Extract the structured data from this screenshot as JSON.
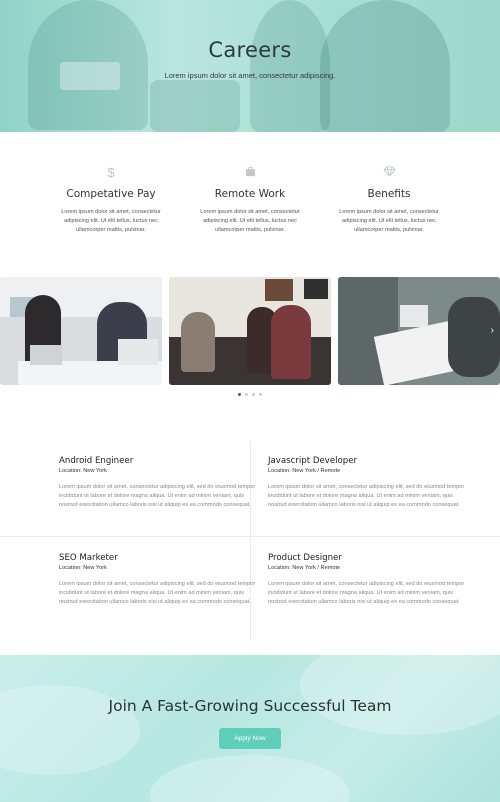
{
  "hero": {
    "title": "Careers",
    "subtitle": "Lorem ipsum dolor sit amet, consectetur adipiscing."
  },
  "features": [
    {
      "icon": "dollar-icon",
      "title": "Competative Pay",
      "text": "Lorem ipsum dolor sit amet, consectetur adipiscing elit. Ut elit tellus, luctus nec ullamcorper mattis, pulvinar."
    },
    {
      "icon": "briefcase-icon",
      "title": "Remote Work",
      "text": "Lorem ipsum dolor sit amet, consectetur adipiscing elit. Ut elit tellus, luctus nec ullamcorper mattis, pulvinar."
    },
    {
      "icon": "diamond-icon",
      "title": "Benefits",
      "text": "Lorem ipsum dolor sit amet, consectetur adipiscing elit. Ut elit tellus, luctus nec ullamcorper mattis, pulvinar."
    }
  ],
  "carousel": {
    "next_icon": "chevron-right-icon",
    "dots": 4,
    "active_dot": 0
  },
  "jobs": [
    {
      "title": "Android Engineer",
      "location": "Location: New York",
      "description": "Lorem ipsum dolor sit amet, consectetur adipiscing elit, sed do eiusmod tempor incididunt ut labore et dolore magna aliqua. Ut enim ad minim veniam, quis nostrud exercitation ullamco laboris nisi ut aliquip ex ea commodo consequat."
    },
    {
      "title": "Javascript Developer",
      "location": "Location: New York / Remote",
      "description": "Lorem ipsum dolor sit amet, consectetur adipiscing elit, sed do eiusmod tempor incididunt ut labore et dolore magna aliqua. Ut enim ad minim veniam, quis nostrud exercitation ullamco laboris nisi ut aliquip ex ea commodo consequat."
    },
    {
      "title": "SEO Marketer",
      "location": "Location: New York",
      "description": "Lorem ipsum dolor sit amet, consectetur adipiscing elit, sed do eiusmod tempor incididunt ut labore et dolore magna aliqua. Ut enim ad minim veniam, quis nostrud exercitation ullamco laboris nisi ut aliquip ex ea commodo consequat."
    },
    {
      "title": "Product Designer",
      "location": "Location: New York / Remote",
      "description": "Lorem ipsum dolor sit amet, consectetur adipiscing elit, sed do eiusmod tempor incididunt ut labore et dolore magna aliqua. Ut enim ad minim veniam, quis nostrud exercitation ullamco laboris nisi ut aliquip ex ea commodo consequat."
    }
  ],
  "cta": {
    "title": "Join A Fast-Growing Successful Team",
    "button": "Apply Now"
  },
  "colors": {
    "accent": "#5fcfbb",
    "hero_tint": "#a8dfd4",
    "cta_tint": "#b7e7e1"
  }
}
